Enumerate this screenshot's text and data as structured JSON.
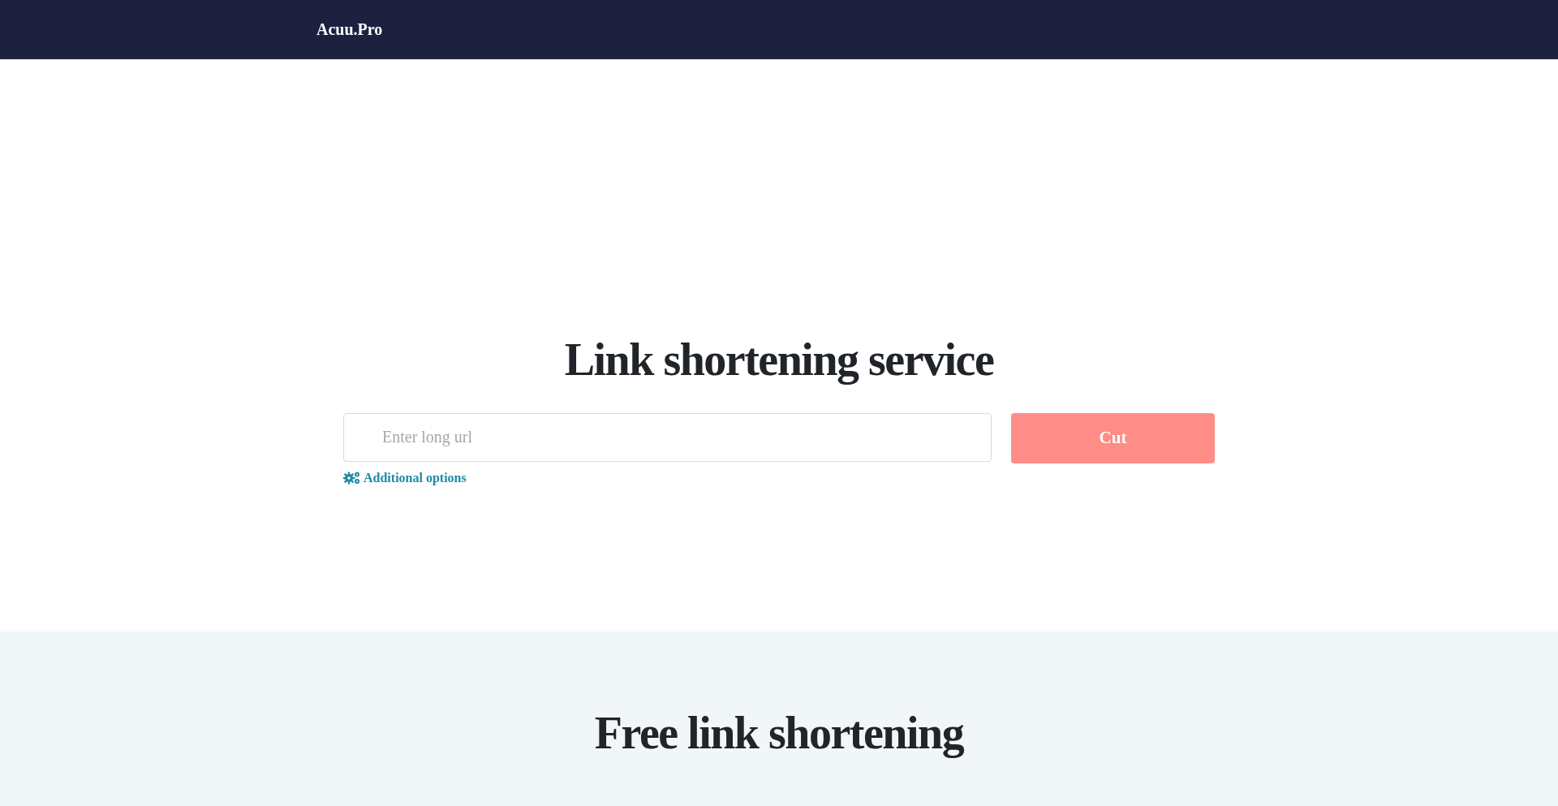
{
  "header": {
    "logo": "Acuu.Pro"
  },
  "hero": {
    "title": "Link shortening service",
    "url_field": {
      "placeholder": "Enter long url"
    },
    "submit_button": "Cut",
    "options_link": "Additional options"
  },
  "features": {
    "title": "Free link shortening"
  }
}
